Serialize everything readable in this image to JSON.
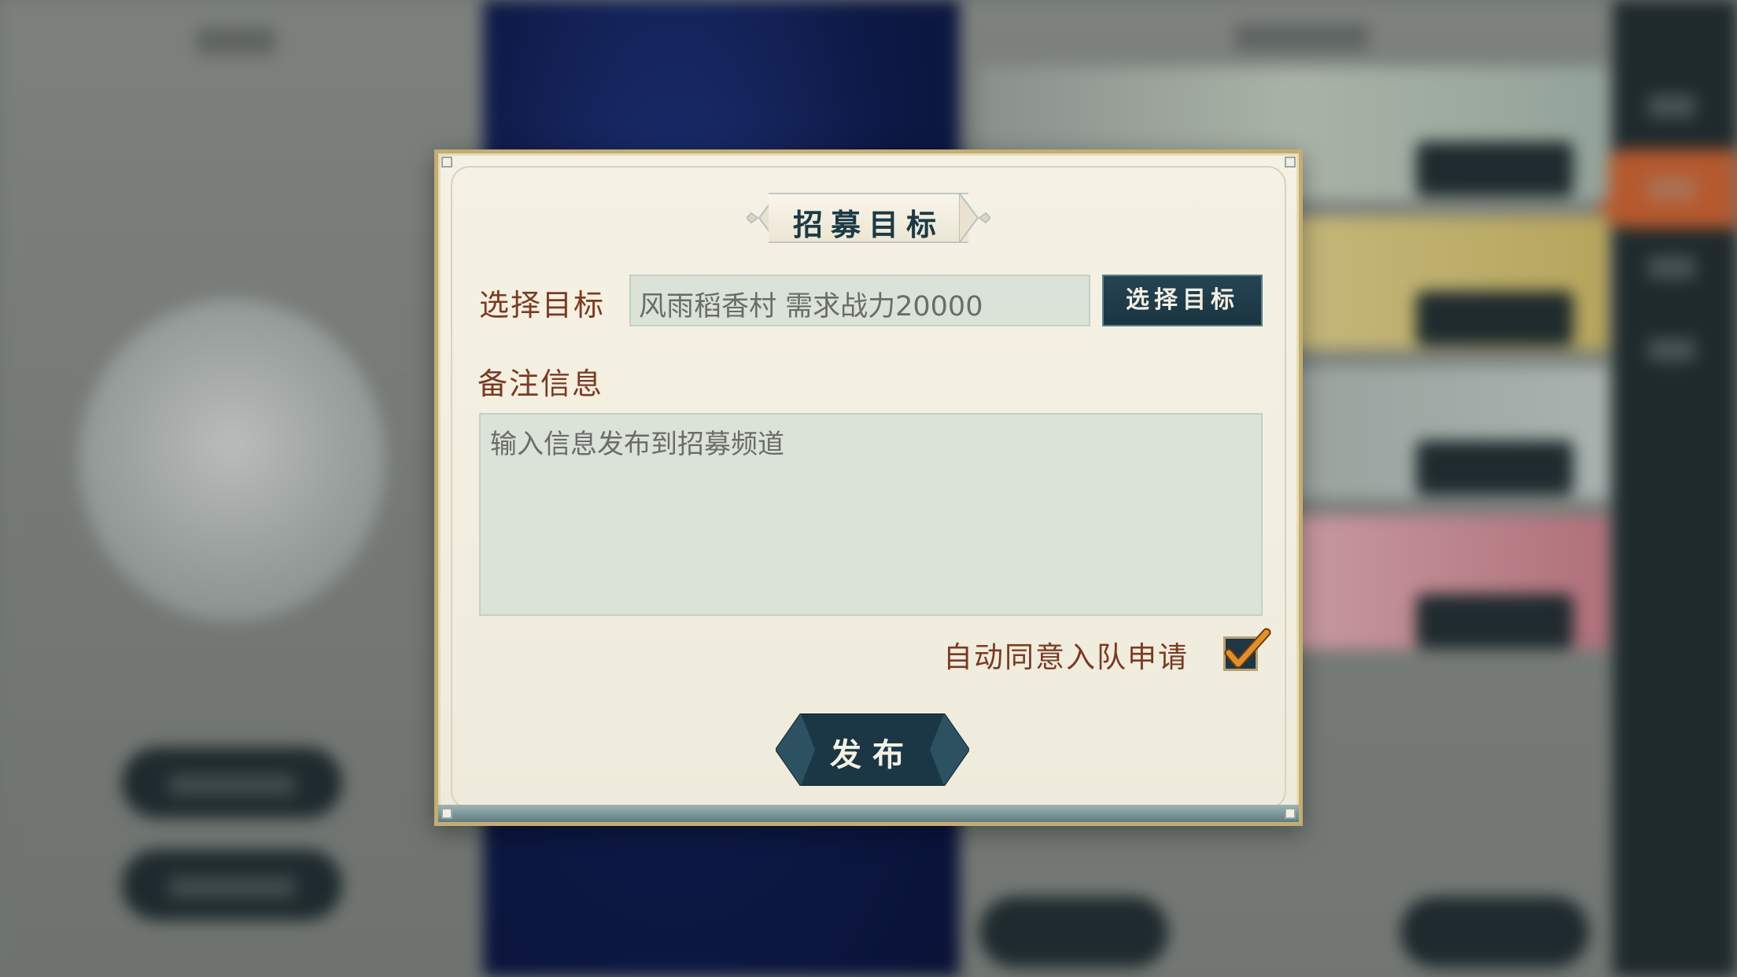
{
  "dialog": {
    "title": "招募目标",
    "select_target_label": "选择目标",
    "target_value": "风雨稻香村 需求战力20000",
    "select_target_button": "选择目标",
    "notes_label": "备注信息",
    "notes_placeholder": "输入信息发布到招募频道",
    "auto_accept_label": "自动同意入队申请",
    "auto_accept_checked": true,
    "publish_button": "发布"
  },
  "colors": {
    "label_brown": "#7a3b22",
    "button_dark_teal": "#1f3a48",
    "dialog_parchment": "#f2eee0",
    "field_bg": "#dbe2d8",
    "check_orange": "#e0902a"
  },
  "icons": {
    "checkmark": "checkmark-icon"
  }
}
